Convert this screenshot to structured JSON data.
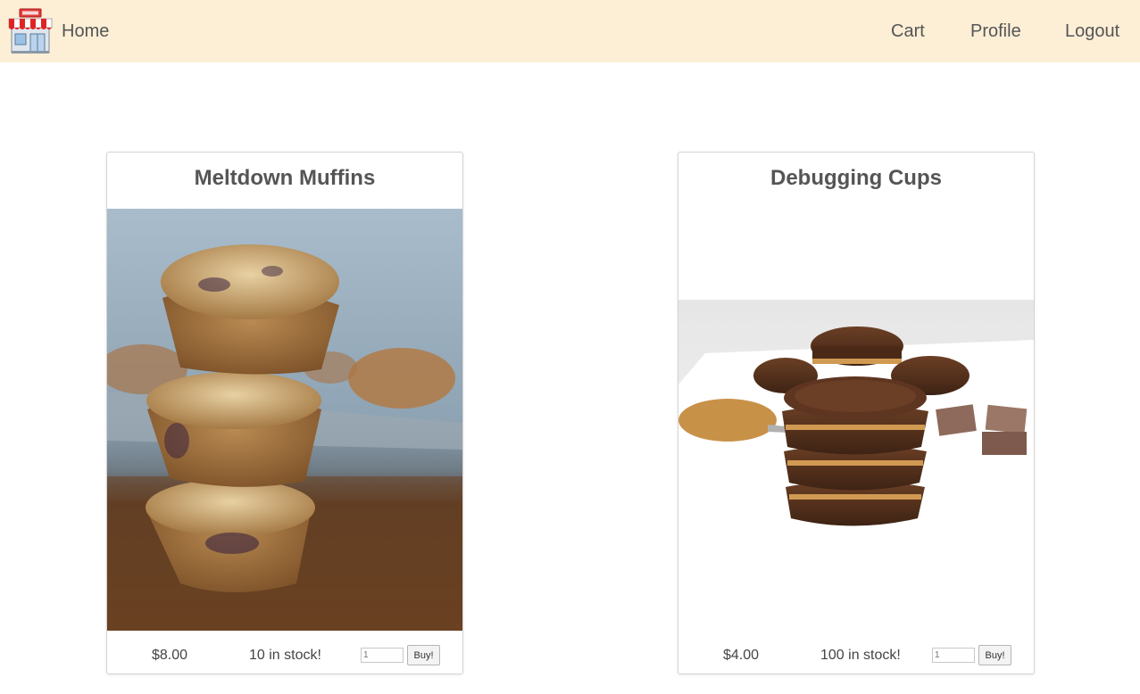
{
  "navbar": {
    "home_label": "Home",
    "links": {
      "cart": "Cart",
      "profile": "Profile",
      "logout": "Logout"
    },
    "background": "#fdefd6"
  },
  "products": [
    {
      "name": "Meltdown Muffins",
      "price": "$8.00",
      "stock": "10 in stock!",
      "quantity": "1",
      "buy_label": "Buy!"
    },
    {
      "name": "Debugging Cups",
      "price": "$4.00",
      "stock": "100 in stock!",
      "quantity": "1",
      "buy_label": "Buy!"
    }
  ],
  "icons": {
    "logo": "shop-storefront-icon"
  }
}
